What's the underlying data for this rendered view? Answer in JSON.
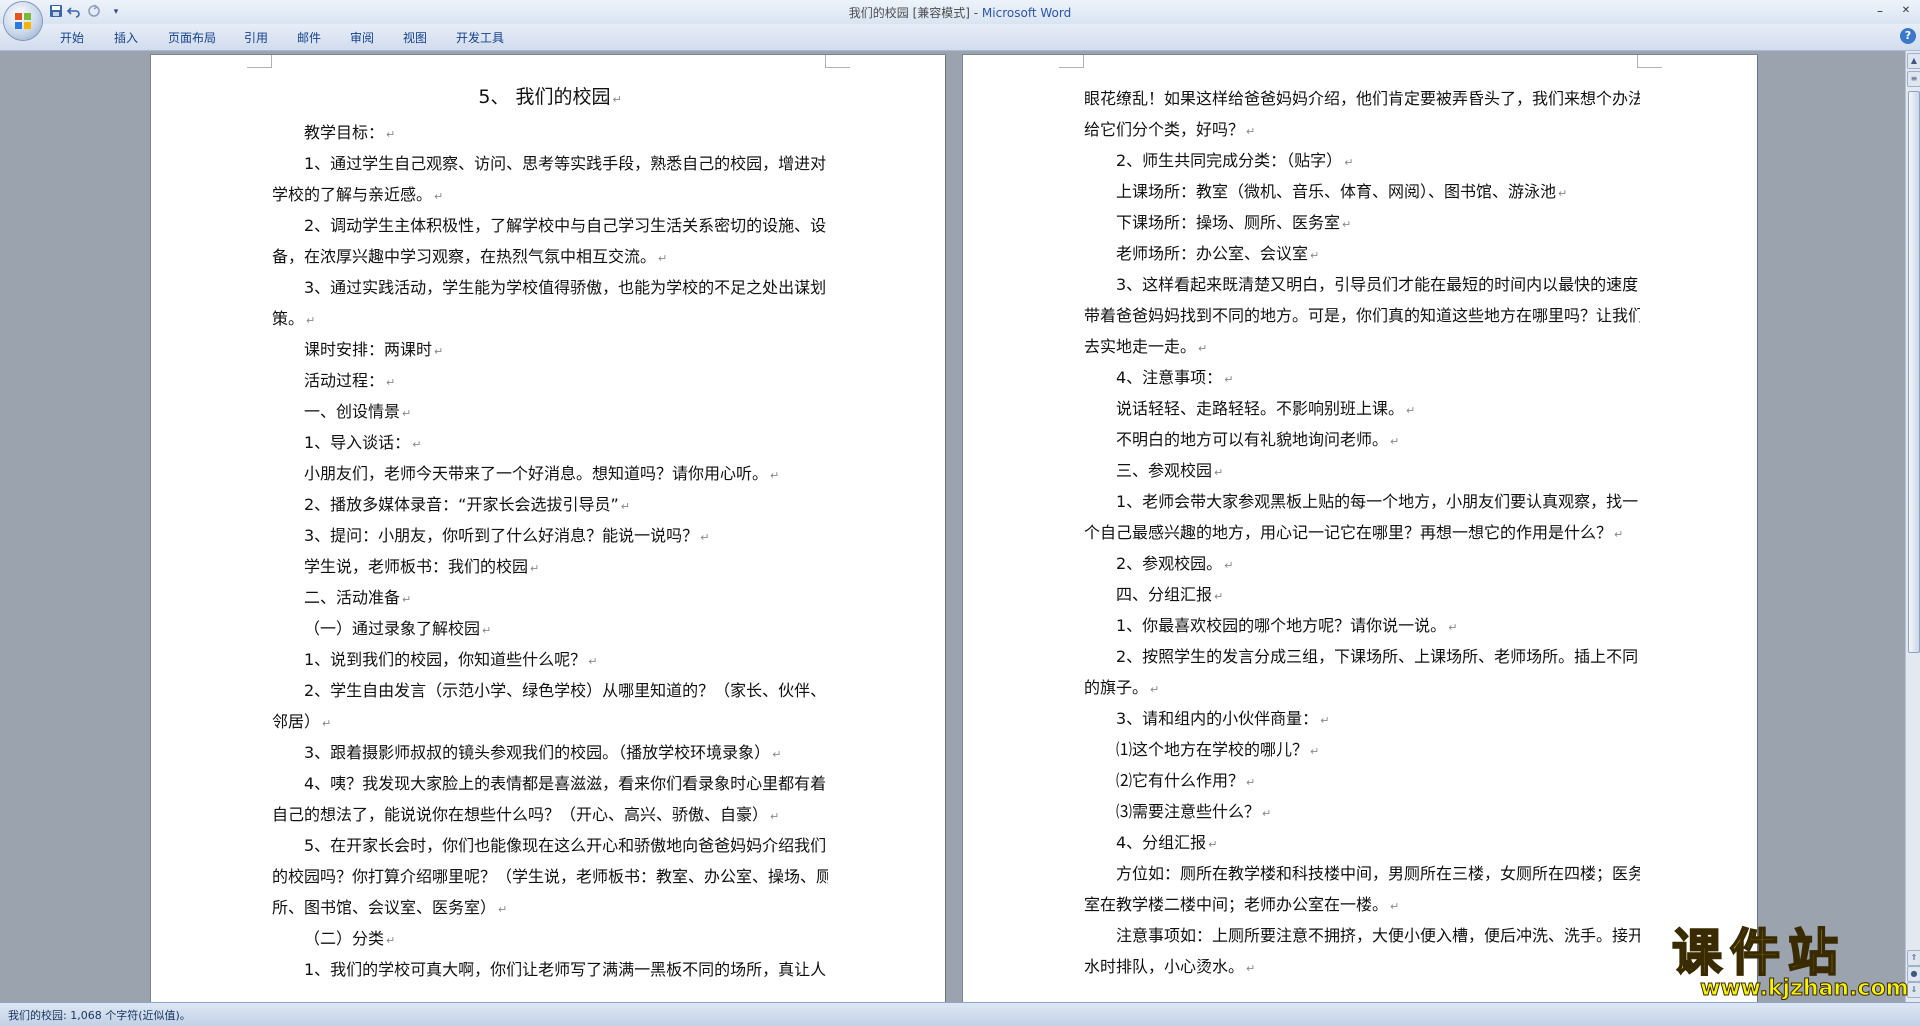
{
  "window": {
    "title_doc": "我们的校园 [兼容模式] - ",
    "title_app": "Microsoft Word",
    "minimize": "–",
    "maximize": "❐",
    "close": "✕"
  },
  "quick_access": {
    "save_icon": "save-icon",
    "undo_icon": "undo-icon",
    "redo_icon": "redo-icon",
    "customize_icon": "dropdown-icon"
  },
  "ribbon": {
    "tabs": [
      "开始",
      "插入",
      "页面布局",
      "引用",
      "邮件",
      "审阅",
      "视图",
      "开发工具"
    ],
    "help": "?"
  },
  "document": {
    "title": "5、  我们的校园",
    "left_lines": [
      {
        "t": "教学目标：",
        "i": true
      },
      {
        "t": "1、通过学生自己观察、访问、思考等实践手段，熟悉自己的校园，增进对",
        "i": true
      },
      {
        "t": "学校的了解与亲近感。",
        "i": false
      },
      {
        "t": "2、调动学生主体积极性，了解学校中与自己学习生活关系密切的设施、设",
        "i": true
      },
      {
        "t": "备，在浓厚兴趣中学习观察，在热烈气氛中相互交流。",
        "i": false
      },
      {
        "t": "3、通过实践活动，学生能为学校值得骄傲，也能为学校的不足之处出谋划",
        "i": true
      },
      {
        "t": "策。",
        "i": false
      },
      {
        "t": "课时安排：两课时",
        "i": true
      },
      {
        "t": "活动过程：",
        "i": true
      },
      {
        "t": "一、创设情景",
        "i": true
      },
      {
        "t": "1、导入谈话：",
        "i": true
      },
      {
        "t": "小朋友们，老师今天带来了一个好消息。想知道吗？请你用心听。",
        "i": true
      },
      {
        "t": "2、播放多媒体录音：“开家长会选拔引导员”",
        "i": true
      },
      {
        "t": "3、提问：小朋友，你听到了什么好消息？能说一说吗？",
        "i": true
      },
      {
        "t": "学生说，老师板书：我们的校园",
        "i": true
      },
      {
        "t": "二、活动准备",
        "i": true
      },
      {
        "t": "（一）通过录象了解校园",
        "i": true
      },
      {
        "t": "1、说到我们的校园，你知道些什么呢？",
        "i": true
      },
      {
        "t": "2、学生自由发言（示范小学、绿色学校）从哪里知道的？（家长、伙伴、",
        "i": true
      },
      {
        "t": "邻居）",
        "i": false
      },
      {
        "t": "3、跟着摄影师叔叔的镜头参观我们的校园。（播放学校环境录象）",
        "i": true
      },
      {
        "t": "4、咦？我发现大家脸上的表情都是喜滋滋，看来你们看录象时心里都有着",
        "i": true
      },
      {
        "t": "自己的想法了，能说说你在想些什么吗？（开心、高兴、骄傲、自豪）",
        "i": false
      },
      {
        "t": "5、在开家长会时，你们也能像现在这么开心和骄傲地向爸爸妈妈介绍我们",
        "i": true
      },
      {
        "t": "的校园吗？你打算介绍哪里呢？（学生说，老师板书：教室、办公室、操场、厕",
        "i": false
      },
      {
        "t": "所、图书馆、会议室、医务室）",
        "i": false
      },
      {
        "t": "（二）分类",
        "i": true
      },
      {
        "t": "1、我们的学校可真大啊，你们让老师写了满满一黑板不同的场所，真让人",
        "i": true
      }
    ],
    "right_lines": [
      {
        "t": "眼花缭乱！如果这样给爸爸妈妈介绍，他们肯定要被弄昏头了，我们来想个办法，",
        "i": false
      },
      {
        "t": "给它们分个类，好吗？",
        "i": false
      },
      {
        "t": "2、师生共同完成分类：（贴字）",
        "i": true
      },
      {
        "t": "上课场所：教室（微机、音乐、体育、网阅）、图书馆、游泳池",
        "i": true
      },
      {
        "t": "下课场所：操场、厕所、医务室",
        "i": true
      },
      {
        "t": "老师场所：办公室、会议室",
        "i": true
      },
      {
        "t": "3、这样看起来既清楚又明白，引导员们才能在最短的时间内以最快的速度",
        "i": true
      },
      {
        "t": "带着爸爸妈妈找到不同的地方。可是，你们真的知道这些地方在哪里吗？让我们",
        "i": false
      },
      {
        "t": "去实地走一走。",
        "i": false
      },
      {
        "t": "4、注意事项：",
        "i": true
      },
      {
        "t": "说话轻轻、走路轻轻。不影响别班上课。",
        "i": true
      },
      {
        "t": "不明白的地方可以有礼貌地询问老师。",
        "i": true
      },
      {
        "t": "三、参观校园",
        "i": true
      },
      {
        "t": "1、老师会带大家参观黑板上贴的每一个地方，小朋友们要认真观察，找一",
        "i": true
      },
      {
        "t": "个自己最感兴趣的地方，用心记一记它在哪里？再想一想它的作用是什么？",
        "i": false
      },
      {
        "t": "2、参观校园。",
        "i": true
      },
      {
        "t": "四、分组汇报",
        "i": true
      },
      {
        "t": "1、你最喜欢校园的哪个地方呢？请你说一说。",
        "i": true
      },
      {
        "t": "2、按照学生的发言分成三组，下课场所、上课场所、老师场所。插上不同",
        "i": true
      },
      {
        "t": "的旗子。",
        "i": false
      },
      {
        "t": "3、请和组内的小伙伴商量：",
        "i": true
      },
      {
        "t": "⑴这个地方在学校的哪儿？",
        "i": true
      },
      {
        "t": "⑵它有什么作用？",
        "i": true
      },
      {
        "t": "⑶需要注意些什么？",
        "i": true
      },
      {
        "t": "4、分组汇报",
        "i": true
      },
      {
        "t": "方位如：厕所在教学楼和科技楼中间，男厕所在三楼，女厕所在四楼；医务",
        "i": true
      },
      {
        "t": "室在教学楼二楼中间；老师办公室在一楼。",
        "i": false
      },
      {
        "t": "注意事项如：上厕所要注意不拥挤，大便小便入槽，便后冲洗、洗手。接开",
        "i": true
      },
      {
        "t": "水时排队，小心烫水。",
        "i": false
      }
    ],
    "paragraph_mark": "↵"
  },
  "status": {
    "text": "我们的校园: 1,068 个字符(近似值)。"
  },
  "watermark": {
    "cn": "课件站",
    "url": "www.kjzhan.com"
  },
  "colors": {
    "accent": "#2a57a8",
    "watermark": "#f6f200"
  }
}
